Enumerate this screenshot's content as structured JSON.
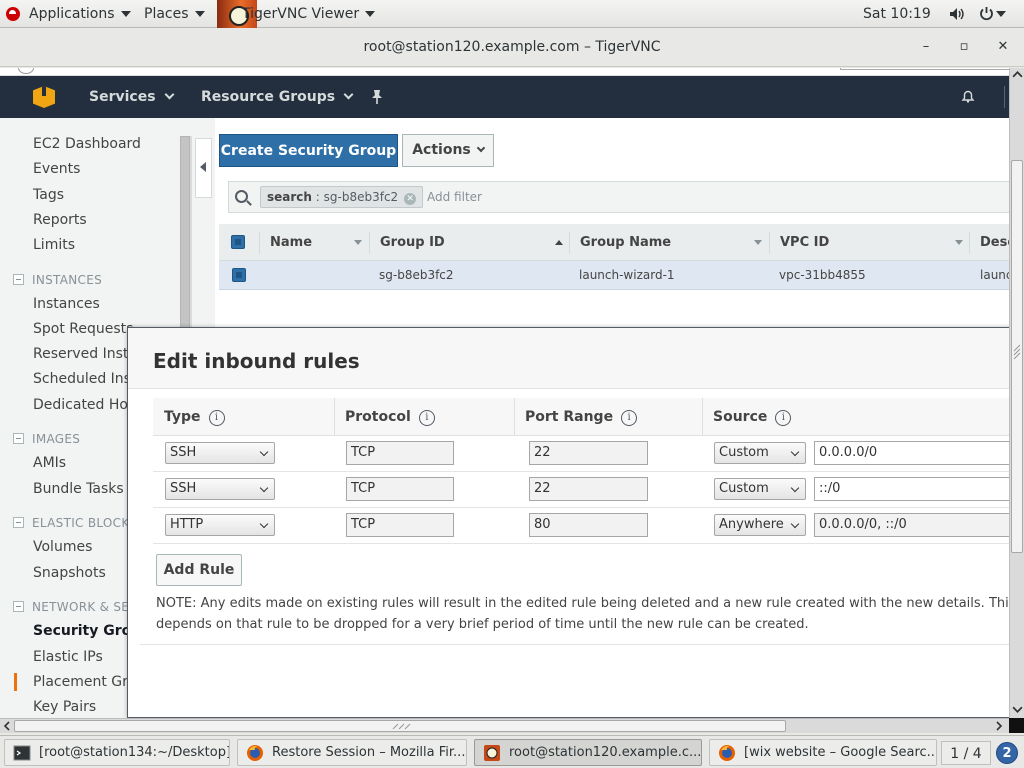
{
  "gnome_topbar": {
    "applications_label": "Applications",
    "places_label": "Places",
    "active_app_label": "TigerVNC Viewer",
    "clock": "Sat 10:19"
  },
  "vnc_window": {
    "title": "root@station120.example.com – TigerVNC",
    "minimize_glyph": "–",
    "maximize_glyph": "▫",
    "close_glyph": "✕"
  },
  "aws_nav": {
    "services_label": "Services",
    "resource_groups_label": "Resource Groups",
    "pin_glyph": "📌",
    "accent_color": "#f0a513",
    "background_color": "#232f3e"
  },
  "sidebar": {
    "top_links": [
      "EC2 Dashboard",
      "Events",
      "Tags",
      "Reports",
      "Limits"
    ],
    "sections": [
      {
        "title": "INSTANCES",
        "items": [
          "Instances",
          "Spot Requests",
          "Reserved Insta",
          "Scheduled Inst",
          "Dedicated Host"
        ]
      },
      {
        "title": "IMAGES",
        "items": [
          "AMIs",
          "Bundle Tasks"
        ]
      },
      {
        "title": "ELASTIC BLOCK",
        "items": [
          "Volumes",
          "Snapshots"
        ]
      },
      {
        "title": "NETWORK & SE",
        "items": [
          "Security Grou",
          "Elastic IPs",
          "Placement Gro",
          "Key Pairs"
        ]
      }
    ],
    "active_item": "Security Grou",
    "active_color": "#ec7211"
  },
  "toolbar": {
    "create_label": "Create Security Group",
    "actions_label": "Actions"
  },
  "filter": {
    "token_key": "search",
    "token_value": ": sg-b8eb3fc2",
    "token_remove_glyph": "✕",
    "placeholder": "Add filter"
  },
  "sg_table": {
    "columns": [
      "Name",
      "Group ID",
      "Group Name",
      "VPC ID",
      "Desc"
    ],
    "sorted_column": "Group ID",
    "row": {
      "name": "",
      "group_id": "sg-b8eb3fc2",
      "group_name": "launch-wizard-1",
      "vpc_id": "vpc-31bb4855",
      "description": "launc"
    }
  },
  "modal": {
    "title": "Edit inbound rules",
    "columns": [
      "Type",
      "Protocol",
      "Port Range",
      "Source"
    ],
    "info_glyph": "i",
    "rules": [
      {
        "type": "SSH",
        "protocol": "TCP",
        "port_range": "22",
        "source_mode": "Custom",
        "source_value": "0.0.0.0/0"
      },
      {
        "type": "SSH",
        "protocol": "TCP",
        "port_range": "22",
        "source_mode": "Custom",
        "source_value": "::/0"
      },
      {
        "type": "HTTP",
        "protocol": "TCP",
        "port_range": "80",
        "source_mode": "Anywhere",
        "source_value": "0.0.0.0/0, ::/0"
      }
    ],
    "add_rule_label": "Add Rule",
    "note_line1": "NOTE: Any edits made on existing rules will result in the edited rule being deleted and a new rule created with the new details. This will c",
    "note_line2": "depends on that rule to be dropped for a very brief period of time until the new rule can be created."
  },
  "taskbar": {
    "items": [
      {
        "label": "[root@station134:~/Desktop]",
        "icon": "terminal-icon",
        "active": false
      },
      {
        "label": "Restore Session – Mozilla Fir...",
        "icon": "firefox-icon",
        "active": false
      },
      {
        "label": "root@station120.example.c...",
        "icon": "tigervnc-icon",
        "active": true
      },
      {
        "label": "[wix website – Google Searc...",
        "icon": "firefox-icon",
        "active": false
      }
    ],
    "workspace": "1 / 4",
    "help_glyph": "2"
  }
}
